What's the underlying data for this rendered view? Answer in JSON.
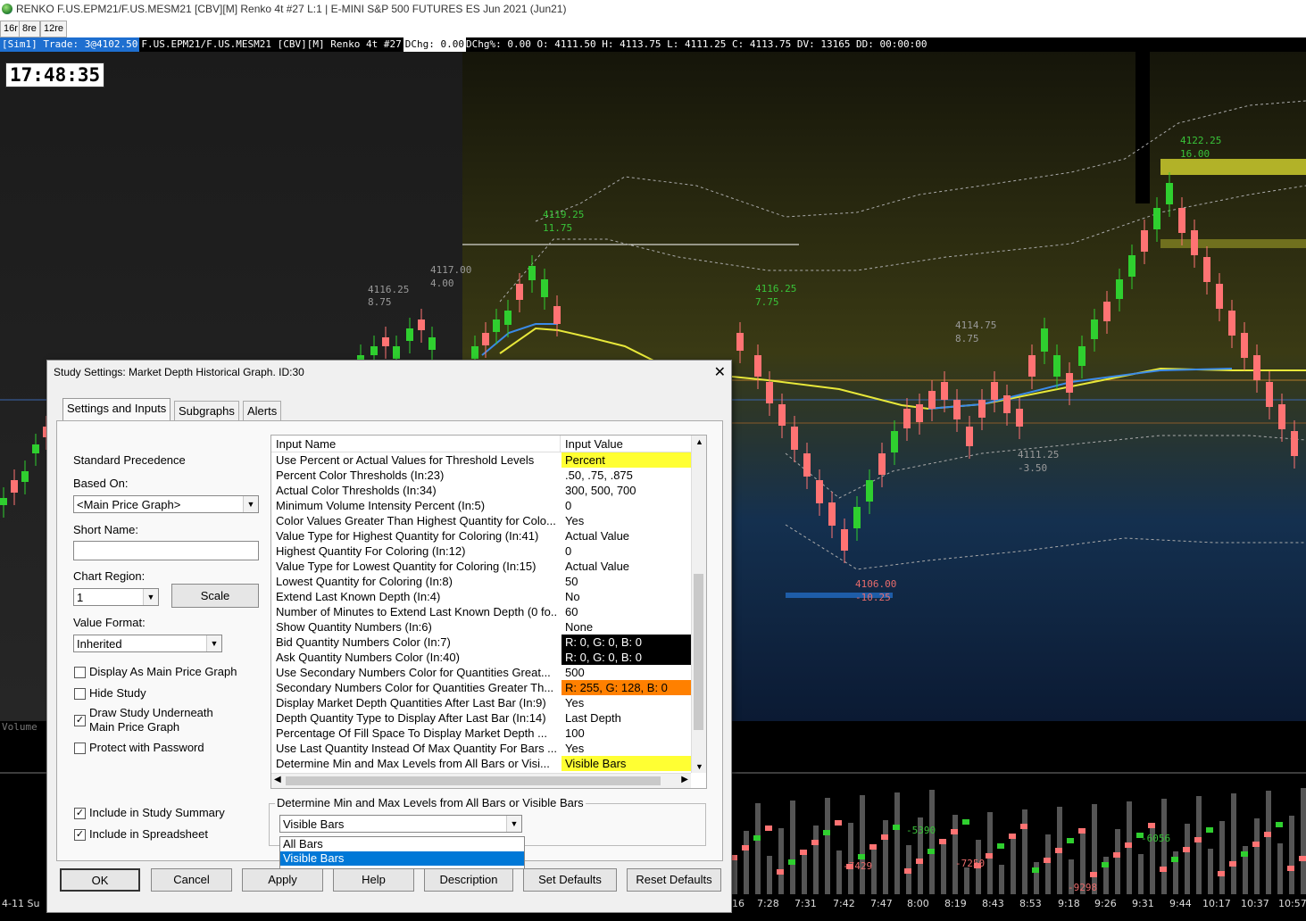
{
  "window": {
    "title": "RENKO F.US.EPM21/F.US.MESM21 [CBV][M]  Renko 4t  #27 L:1 | E-MINI S&P 500 FUTURES ES Jun 2021 (Jun21)"
  },
  "chart_tabs": [
    "16r",
    "8re",
    "12re"
  ],
  "info_bar": {
    "sim": "[Sim1]  Trade: 3@4102.50",
    "symbol": "F.US.EPM21/F.US.MESM21 [CBV][M]  Renko 4t #27",
    "dchg": "DChg: 0.00",
    "rest": "DChg%: 0.00 O: 4111.50 H: 4113.75 L: 4111.25 C: 4113.75 DV: 13165 DD: 00:00:00"
  },
  "clock": "17:48:35",
  "chart_labels": {
    "peaks": [
      {
        "price": "4116.25",
        "delta": "8.75"
      },
      {
        "price": "4117.00",
        "delta": "4.00"
      },
      {
        "price": "4119.25",
        "delta": "11.75"
      },
      {
        "price": "4116.25",
        "delta": "7.75"
      },
      {
        "price": "4114.75",
        "delta": "8.75"
      },
      {
        "price": "4111.25",
        "delta": "-3.50"
      },
      {
        "price": "4106.00",
        "delta": "-10.25"
      },
      {
        "price": "4122.25",
        "delta": "16.00"
      }
    ],
    "volume_label": "Volume",
    "delta_values": [
      "-5390",
      "-7429",
      "-7250",
      "-6056",
      "-9298"
    ],
    "time_axis": [
      "4-11 Su",
      "16",
      "7:28",
      "7:31",
      "7:42",
      "7:47",
      "8:00",
      "8:19",
      "8:43",
      "8:53",
      "9:18",
      "9:26",
      "9:31",
      "9:44",
      "10:17",
      "10:37",
      "10:57"
    ]
  },
  "dialog": {
    "title": "Study Settings: Market Depth Historical Graph. ID:30",
    "tabs": [
      "Settings and Inputs",
      "Subgraphs",
      "Alerts"
    ],
    "left": {
      "standard_precedence": "Standard Precedence",
      "based_on_label": "Based On:",
      "based_on_value": "<Main Price Graph>",
      "short_name_label": "Short Name:",
      "short_name_value": "",
      "chart_region_label": "Chart Region:",
      "chart_region_value": "1",
      "scale_button": "Scale",
      "value_format_label": "Value Format:",
      "value_format_value": "Inherited",
      "checkboxes": [
        {
          "label": "Display As Main Price Graph",
          "checked": false
        },
        {
          "label": "Hide Study",
          "checked": false
        },
        {
          "label": "Draw Study Underneath",
          "label2": "Main Price Graph",
          "checked": true
        },
        {
          "label": "Protect with Password",
          "checked": false
        },
        {
          "label": "Include in Study Summary",
          "checked": true
        },
        {
          "label": "Include in Spreadsheet",
          "checked": true
        }
      ]
    },
    "grid": {
      "col_name": "Input Name",
      "col_value": "Input Value",
      "rows": [
        {
          "name": "Use Percent or Actual Values for Threshold Levels",
          "value": "Percent",
          "style": "hl"
        },
        {
          "name": "Percent Color Thresholds  (In:23)",
          "value": ".50, .75, .875"
        },
        {
          "name": "Actual Color Thresholds  (In:34)",
          "value": "300, 500, 700"
        },
        {
          "name": "Minimum Volume Intensity Percent  (In:5)",
          "value": "0"
        },
        {
          "name": "Color Values Greater Than Highest Quantity for Colo...",
          "value": "Yes"
        },
        {
          "name": "Value Type for Highest Quantity for Coloring  (In:41)",
          "value": "Actual Value"
        },
        {
          "name": "Highest Quantity For Coloring  (In:12)",
          "value": "0"
        },
        {
          "name": "Value Type for Lowest Quantity for Coloring  (In:15)",
          "value": "Actual Value"
        },
        {
          "name": "Lowest Quantity for Coloring  (In:8)",
          "value": "50"
        },
        {
          "name": "Extend Last Known Depth  (In:4)",
          "value": "No"
        },
        {
          "name": "Number of Minutes to Extend Last Known Depth (0 fo...",
          "value": "60"
        },
        {
          "name": "Show Quantity Numbers  (In:6)",
          "value": "None"
        },
        {
          "name": "Bid Quantity Numbers Color  (In:7)",
          "value": "R: 0, G: 0, B: 0",
          "style": "black"
        },
        {
          "name": "Ask Quantity Numbers Color  (In:40)",
          "value": "R: 0, G: 0, B: 0",
          "style": "black"
        },
        {
          "name": "Use Secondary Numbers Color for Quantities Great...",
          "value": "500"
        },
        {
          "name": "Secondary Numbers Color for Quantities Greater Th...",
          "value": "R: 255, G: 128, B: 0",
          "style": "orange"
        },
        {
          "name": "Display Market Depth Quantities After Last Bar  (In:9)",
          "value": "Yes"
        },
        {
          "name": "Depth Quantity Type to Display After Last Bar  (In:14)",
          "value": "Last Depth"
        },
        {
          "name": "Percentage Of Fill Space To Display Market Depth ...",
          "value": "100"
        },
        {
          "name": "Use Last Quantity Instead Of Max Quantity For Bars ...",
          "value": "Yes"
        },
        {
          "name": "Determine Min and Max Levels from All Bars or Visi...",
          "value": "Visible Bars",
          "style": "hl"
        }
      ]
    },
    "selected_input": {
      "label": "Determine Min and Max Levels from All Bars or Visible Bars",
      "value": "Visible Bars",
      "options": [
        "All Bars",
        "Visible Bars"
      ]
    },
    "buttons": [
      "OK",
      "Cancel",
      "Apply",
      "Help",
      "Description",
      "Set Defaults",
      "Reset Defaults"
    ],
    "colors": {
      "highlight": "#ffff33",
      "black_swatch": "#000000",
      "orange_swatch": "#ff8000",
      "selection": "#0078d7"
    }
  }
}
